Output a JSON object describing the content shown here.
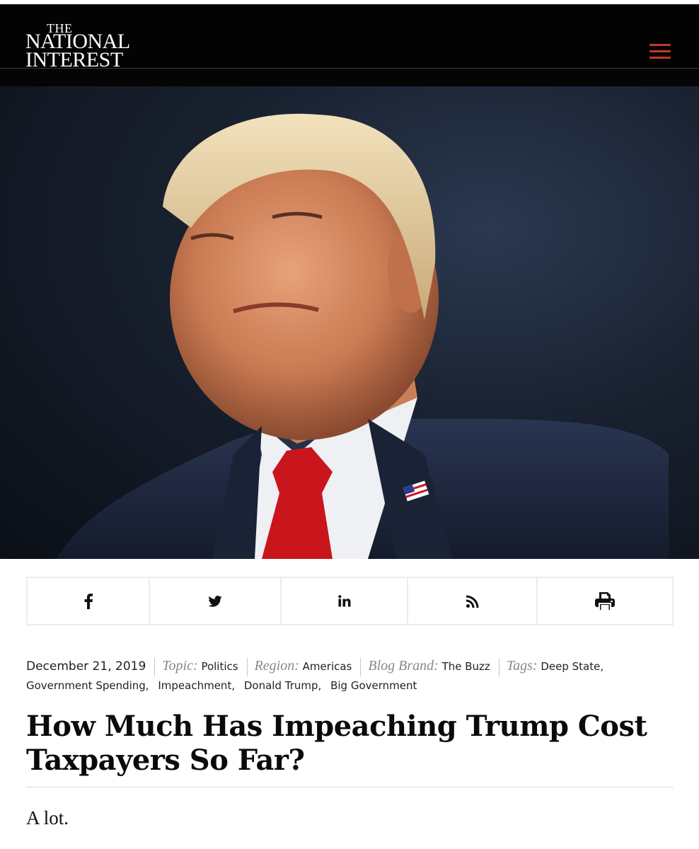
{
  "site": {
    "logo": {
      "line1": "THE",
      "line2": "NATIONAL",
      "line3": "INTEREST"
    },
    "menu_icon": "hamburger-menu-icon",
    "menu_color": "#c0392b"
  },
  "hero": {
    "description_icon": "hero-photo"
  },
  "share": {
    "items": [
      {
        "icon": "facebook-icon"
      },
      {
        "icon": "twitter-icon"
      },
      {
        "icon": "linkedin-icon"
      },
      {
        "icon": "rss-icon"
      },
      {
        "icon": "print-icon"
      }
    ]
  },
  "meta": {
    "date": "December 21, 2019",
    "topic_label": "Topic:",
    "topic_value": "Politics",
    "region_label": "Region:",
    "region_value": "Americas",
    "brand_label": "Blog Brand:",
    "brand_value": "The Buzz",
    "tags_label": "Tags:",
    "tags": [
      "Deep State,",
      "Government Spending,",
      "Impeachment,",
      "Donald Trump,",
      "Big Government"
    ]
  },
  "article": {
    "headline": "How Much Has Impeaching Trump Cost Taxpayers So Far?",
    "dek": "A lot."
  }
}
